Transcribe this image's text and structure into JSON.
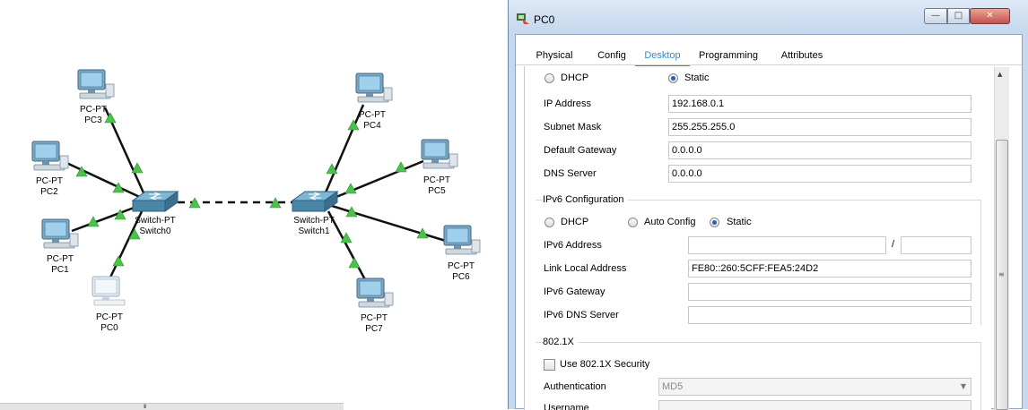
{
  "topology": {
    "nodes": [
      {
        "id": "pc3",
        "type": "PC-PT",
        "name": "PC3"
      },
      {
        "id": "pc2",
        "type": "PC-PT",
        "name": "PC2"
      },
      {
        "id": "pc1",
        "type": "PC-PT",
        "name": "PC1"
      },
      {
        "id": "pc0",
        "type": "PC-PT",
        "name": "PC0"
      },
      {
        "id": "switch0",
        "type": "Switch-PT",
        "name": "Switch0"
      },
      {
        "id": "switch1",
        "type": "Switch-PT",
        "name": "Switch1"
      },
      {
        "id": "pc4",
        "type": "PC-PT",
        "name": "PC4"
      },
      {
        "id": "pc5",
        "type": "PC-PT",
        "name": "PC5"
      },
      {
        "id": "pc6",
        "type": "PC-PT",
        "name": "PC6"
      },
      {
        "id": "pc7",
        "type": "PC-PT",
        "name": "PC7"
      }
    ],
    "colors": {
      "link": "#111111",
      "link_up": "#4cc24c",
      "switch": "#4a86a8",
      "pc_screen": "#6aa3c9",
      "pc_body": "#7a9db5"
    },
    "scroll_grip": "III"
  },
  "window": {
    "title": "PC0",
    "icon": "packet-tracer-icon",
    "controls": {
      "minimize": "—",
      "maximize": "□",
      "close": "✕"
    },
    "tabs": [
      "Physical",
      "Config",
      "Desktop",
      "Programming",
      "Attributes"
    ],
    "active_tab": "Desktop",
    "accent": "#2a8ecb"
  },
  "ip_config": {
    "ipv4_mode": {
      "dhcp": "DHCP",
      "static": "Static",
      "selected": "Static"
    },
    "ip_address": {
      "label": "IP Address",
      "value": "192.168.0.1"
    },
    "subnet_mask": {
      "label": "Subnet Mask",
      "value": "255.255.255.0"
    },
    "default_gateway": {
      "label": "Default Gateway",
      "value": "0.0.0.0"
    },
    "dns_server": {
      "label": "DNS Server",
      "value": "0.0.0.0"
    },
    "ipv6": {
      "title": "IPv6 Configuration",
      "mode": {
        "dhcp": "DHCP",
        "auto": "Auto Config",
        "static": "Static",
        "selected": "Static"
      },
      "address": {
        "label": "IPv6 Address",
        "value": "",
        "prefix": "",
        "separator": "/"
      },
      "link_local": {
        "label": "Link Local Address",
        "value": "FE80::260:5CFF:FEA5:24D2"
      },
      "gateway": {
        "label": "IPv6 Gateway",
        "value": ""
      },
      "dns": {
        "label": "IPv6 DNS Server",
        "value": ""
      }
    },
    "dot1x": {
      "title": "802.1X",
      "use_label": "Use 802.1X Security",
      "use_checked": false,
      "auth_label": "Authentication",
      "auth_value": "MD5",
      "username_label": "Username"
    }
  },
  "scrollbar": {
    "up": "▲",
    "grip": "≡"
  }
}
